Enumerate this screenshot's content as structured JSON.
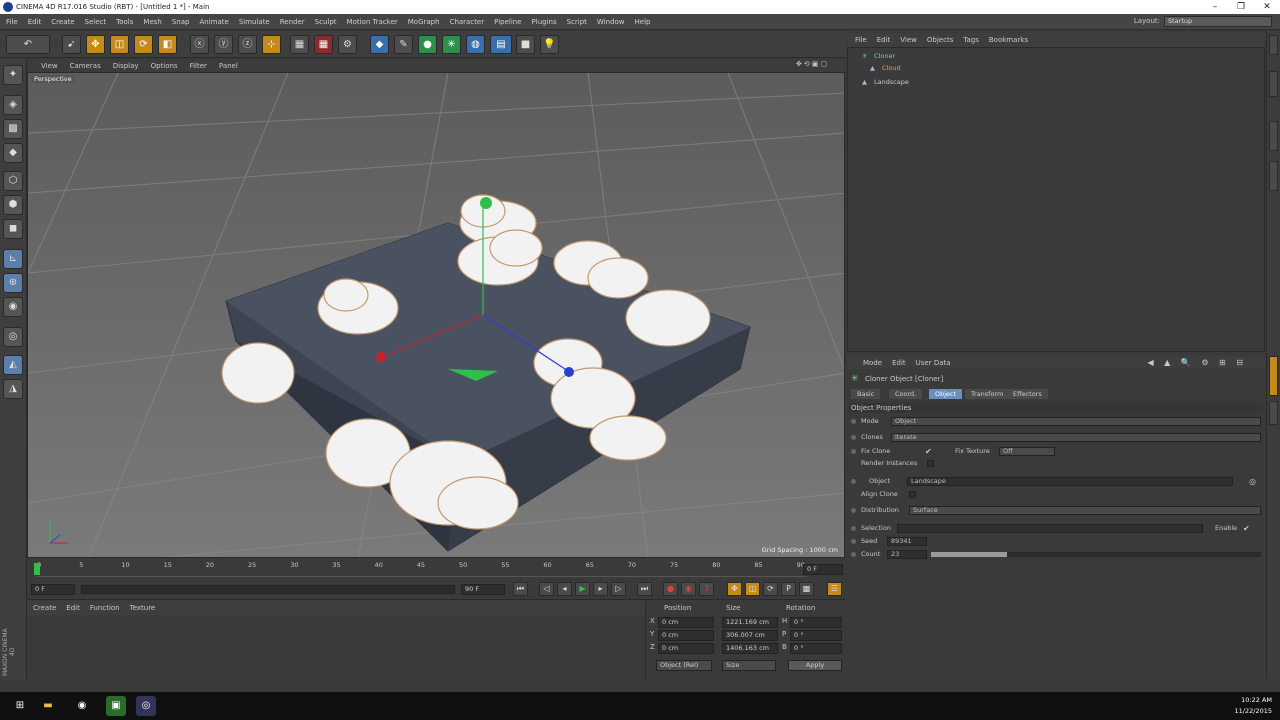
{
  "window": {
    "title": "CINEMA 4D R17.016 Studio (RBT) - [Untitled 1 *] - Main",
    "btn_min": "–",
    "btn_max": "❐",
    "btn_close": "✕"
  },
  "menubar": {
    "items": [
      "File",
      "Edit",
      "Create",
      "Select",
      "Tools",
      "Mesh",
      "Snap",
      "Animate",
      "Simulate",
      "Render",
      "Sculpt",
      "Motion Tracker",
      "MoGraph",
      "Character",
      "Pipeline",
      "Plugins",
      "Script",
      "Window",
      "Help"
    ],
    "layout_label": "Layout:",
    "layout_value": "Startup"
  },
  "viewport": {
    "menu": [
      "View",
      "Cameras",
      "Display",
      "Options",
      "Filter",
      "Panel"
    ],
    "label": "Perspective",
    "grid_spacing": "Grid Spacing : 1000 cm"
  },
  "timeline": {
    "ticks": [
      "0",
      "5",
      "10",
      "15",
      "20",
      "25",
      "30",
      "35",
      "40",
      "45",
      "50",
      "55",
      "60",
      "65",
      "70",
      "75",
      "80",
      "85",
      "90"
    ],
    "current_frame": "0 F",
    "start": "0 F",
    "end": "90 F",
    "end2": "90 F"
  },
  "material_manager": {
    "menu": [
      "Create",
      "Edit",
      "Function",
      "Texture"
    ]
  },
  "coordinates": {
    "headers": [
      "Position",
      "Size",
      "Rotation"
    ],
    "rows": [
      {
        "axis": "X",
        "pos": "0 cm",
        "size": "1221.169 cm",
        "rot_axis": "H",
        "rot": "0 °"
      },
      {
        "axis": "Y",
        "pos": "0 cm",
        "size": "306.007 cm",
        "rot_axis": "P",
        "rot": "0 °"
      },
      {
        "axis": "Z",
        "pos": "0 cm",
        "size": "1406.163 cm",
        "rot_axis": "B",
        "rot": "0 °"
      }
    ],
    "mode": "Object (Rel)",
    "size_mode": "Size",
    "apply": "Apply"
  },
  "object_manager": {
    "menu": [
      "File",
      "Edit",
      "View",
      "Objects",
      "Tags",
      "Bookmarks"
    ],
    "objects": [
      {
        "name": "Cloner",
        "color": "#7fd08a"
      },
      {
        "name": "Cloud",
        "color": "#e0a030"
      },
      {
        "name": "Landscape",
        "color": "#c8c8c8"
      }
    ]
  },
  "attributes": {
    "menu": [
      "Mode",
      "Edit",
      "User Data"
    ],
    "header": "Cloner Object [Cloner]",
    "tabs": [
      "Basic",
      "Coord.",
      "Object",
      "Transform",
      "Effectors"
    ],
    "active_tab": "Object",
    "section": "Object Properties",
    "props": {
      "mode_label": "Mode",
      "mode_value": "Object",
      "clones_label": "Clones",
      "clones_value": "Iterate",
      "fix_clone_label": "Fix Clone",
      "fix_texture_label": "Fix Texture",
      "fix_texture_value": "Off",
      "render_instances_label": "Render Instances",
      "object_label": "Object",
      "object_value": "Landscape",
      "align_clone_label": "Align Clone",
      "distribution_label": "Distribution",
      "distribution_value": "Surface",
      "selection_label": "Selection",
      "enable_label": "Enable",
      "seed_label": "Seed",
      "seed_value": "89341",
      "count_label": "Count",
      "count_value": "23"
    },
    "count_fraction": 0.23
  },
  "taskbar": {
    "time": "10:22 AM",
    "date": "11/22/2015"
  },
  "brand": {
    "logo_text": "MAXON CINEMA 4D"
  }
}
